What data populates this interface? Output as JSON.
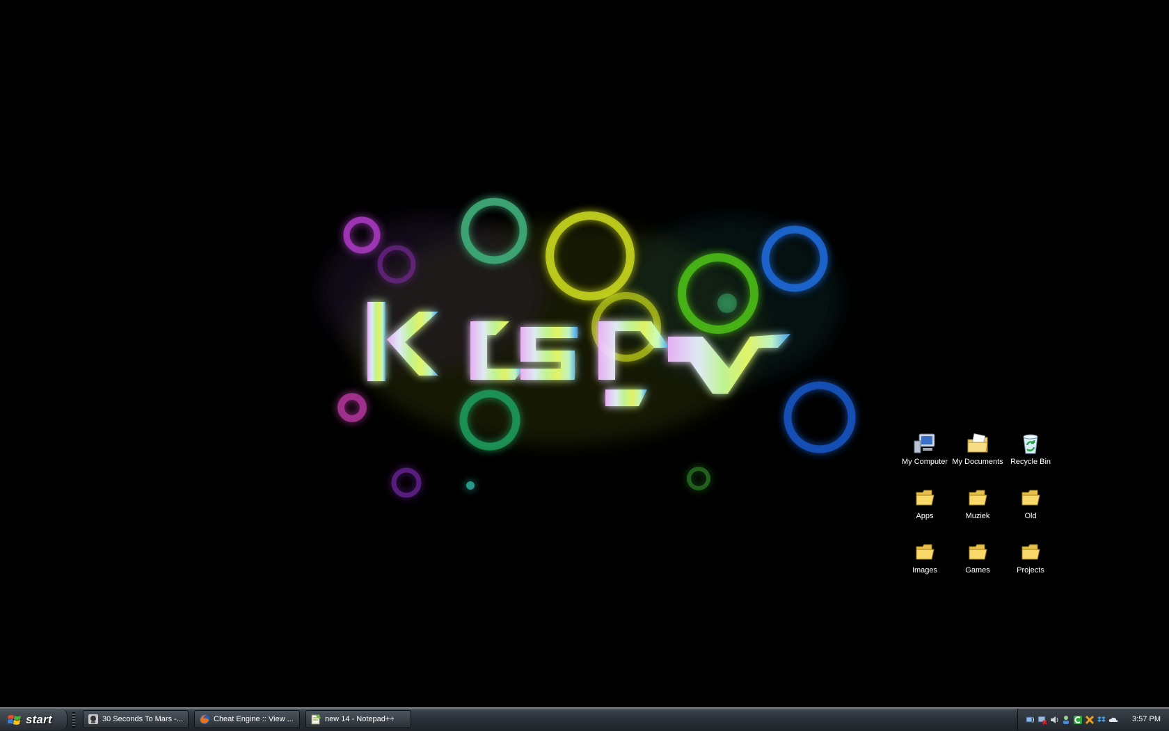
{
  "desktop": {
    "icons": [
      {
        "label": "My Computer",
        "icon": "my-computer-icon"
      },
      {
        "label": "My Documents",
        "icon": "my-documents-icon"
      },
      {
        "label": "Recycle Bin",
        "icon": "recycle-bin-icon"
      },
      {
        "label": "Apps",
        "icon": "folder-icon"
      },
      {
        "label": "Muziek",
        "icon": "folder-icon"
      },
      {
        "label": "Old",
        "icon": "folder-icon"
      },
      {
        "label": "Images",
        "icon": "folder-icon"
      },
      {
        "label": "Games",
        "icon": "folder-icon"
      },
      {
        "label": "Projects",
        "icon": "folder-icon"
      }
    ]
  },
  "taskbar": {
    "start_label": "start",
    "tasks": [
      {
        "label": "30 Seconds To Mars -...",
        "icon": "winamp-icon"
      },
      {
        "label": "Cheat Engine :: View ...",
        "icon": "firefox-icon"
      },
      {
        "label": "new  14 - Notepad++",
        "icon": "notepad-icon"
      }
    ],
    "tray_icons": [
      "network-icon",
      "network-disconnected-icon",
      "audio-icon",
      "user-icon",
      "green-c-icon",
      "tool-icon",
      "dropbox-icon",
      "cloud-icon"
    ],
    "clock": "3:57 PM"
  },
  "colors": {
    "wallpaper_bg": "#000000",
    "taskbar": "#2a3038"
  }
}
